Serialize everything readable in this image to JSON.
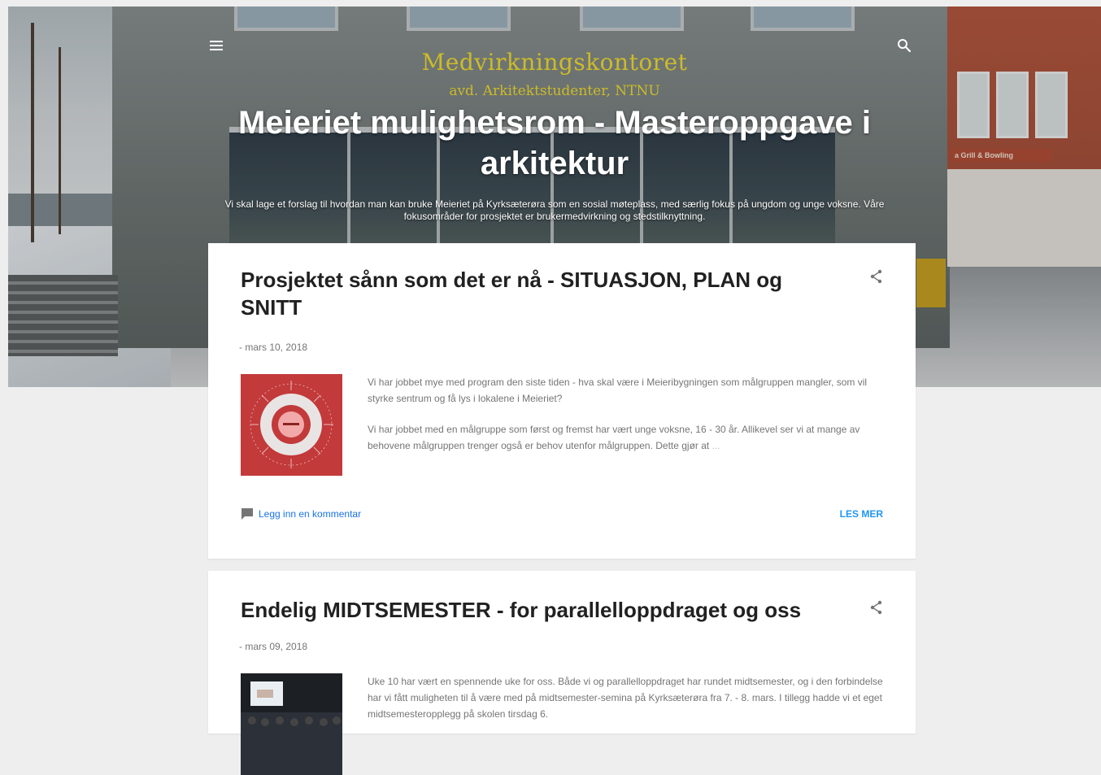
{
  "header": {
    "logo_line1": "Medvirkningskontoret",
    "logo_line2": "avd. Arkitektstudenter, NTNU",
    "title": "Meieriet mulighetsrom - Masteroppgave i arkitektur",
    "description": "Vi skal lage et forslag til hvordan man kan bruke Meieriet på Kyrksæterøra som en sosial møteplass, med særlig fokus på ungdom og unge voksne. Våre fokusområder for prosjektet er brukermedvirkning og stedstilknyttning.",
    "menu_icon": "hamburger-menu-icon",
    "search_icon": "search-icon",
    "sign_text": "a Grill & Bowling"
  },
  "posts": [
    {
      "title": "Prosjektet sånn som det er nå - SITUASJON, PLAN og SNITT",
      "date": "- mars 10, 2018",
      "snippet_p1": "Vi har jobbet mye med program den siste tiden - hva skal være i Meieribygningen som målgruppen mangler, som vil styrke sentrum og få lys i lokalene i Meieriet?",
      "snippet_p2": "Vi har jobbet med en målgruppe som først og fremst har vært unge voksne, 16 - 30 år. Allikevel ser vi at mange av behovene målgruppen trenger også er behov utenfor målgruppen. Dette gjør at",
      "snippet_p2_fade": "...",
      "comment_label": "Legg inn en kommentar",
      "read_more": "LES MER"
    },
    {
      "title": "Endelig MIDTSEMESTER - for parallelloppdraget og oss",
      "date": "- mars 09, 2018",
      "snippet_p1": "Uke 10 har vært en spennende uke for oss. Både vi og parallelloppdraget har rundet midtsemester, og i den forbindelse har vi fått muligheten til å være med på midtsemester-semina på Kyrksæterøra fra 7. - 8. mars. I tillegg hadde vi et eget midtsemesteropplegg på skolen tirsdag 6."
    }
  ],
  "colors": {
    "page_bg": "#eeeeee",
    "card_bg": "#ffffff",
    "title_text": "#212121",
    "meta_text": "#757575",
    "link_blue": "#2196f3",
    "logo_yellow": "#d7c321"
  }
}
